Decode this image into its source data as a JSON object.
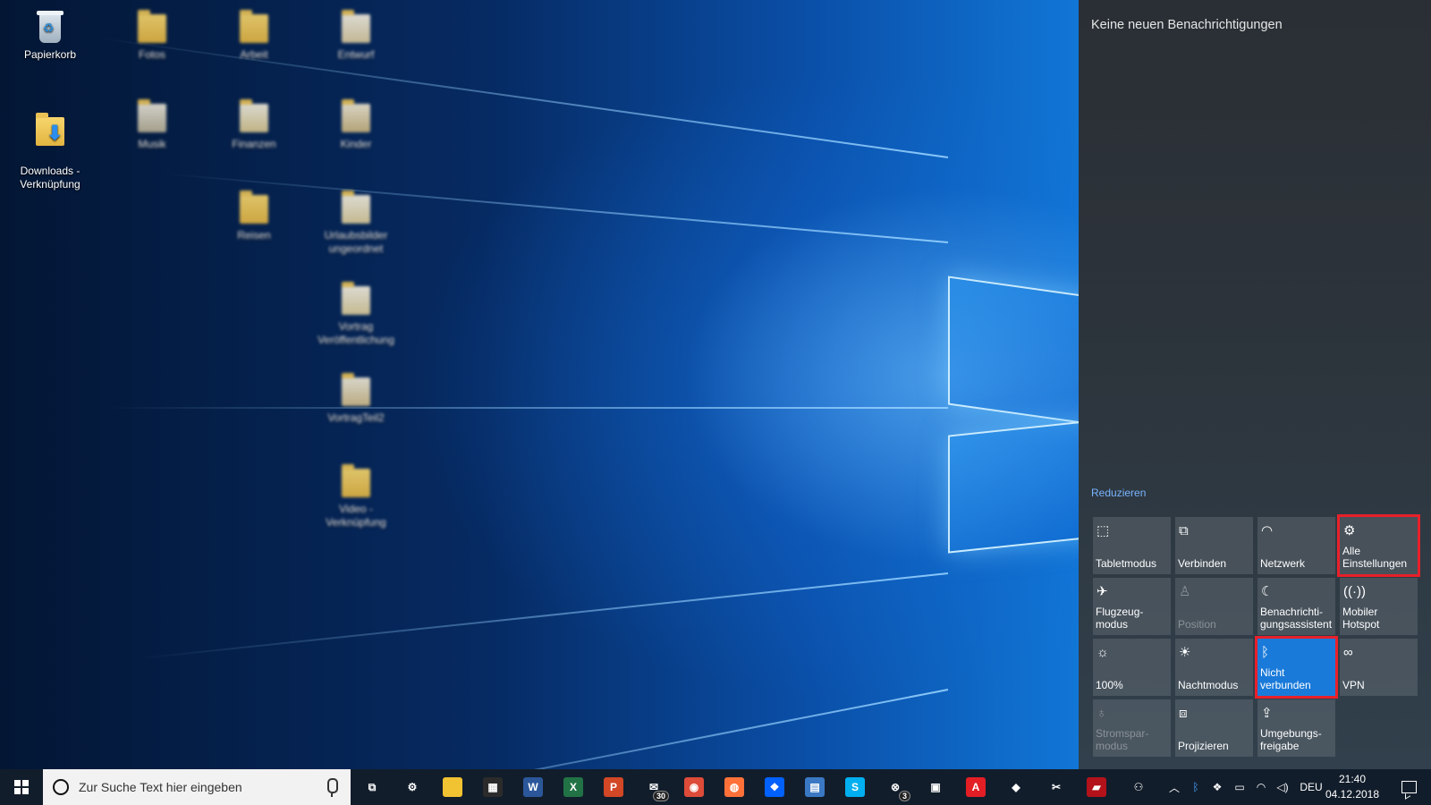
{
  "desktop": {
    "icons": [
      {
        "label": "Papierkorb",
        "type": "recycle-bin",
        "blurred": false
      },
      {
        "label": "Downloads -\nVerknüpfung",
        "type": "shortcut-folder",
        "blurred": false
      },
      {
        "label": "Fotos",
        "type": "folder",
        "blurred": true
      },
      {
        "label": "Musik",
        "type": "folder",
        "blurred": true
      },
      {
        "label": "Arbeit",
        "type": "folder",
        "blurred": true
      },
      {
        "label": "Finanzen",
        "type": "folder",
        "blurred": true
      },
      {
        "label": "Reisen",
        "type": "folder",
        "blurred": true
      },
      {
        "label": "Entwurf",
        "type": "folder",
        "blurred": true
      },
      {
        "label": "Kinder",
        "type": "folder",
        "blurred": true
      },
      {
        "label": "Urlaubsbilder ungeordnet",
        "type": "folder",
        "blurred": true
      },
      {
        "label": "Vortrag Veröffentlichung",
        "type": "folder",
        "blurred": true
      },
      {
        "label": "VortragTeil2",
        "type": "folder",
        "blurred": true
      },
      {
        "label": "Video - Verknüpfung",
        "type": "shortcut-folder",
        "blurred": true
      }
    ]
  },
  "action_center": {
    "title": "Keine neuen Benachrichtigungen",
    "reduce_label": "Reduzieren",
    "tiles": [
      {
        "label": "Tabletmodus",
        "icon": "tablet-mode-icon",
        "glyph": "⬚",
        "state": "normal",
        "highlighted": false
      },
      {
        "label": "Verbinden",
        "icon": "connect-icon",
        "glyph": "⧉",
        "state": "normal",
        "highlighted": false
      },
      {
        "label": "Netzwerk",
        "icon": "network-icon",
        "glyph": "◠",
        "state": "normal",
        "highlighted": false
      },
      {
        "label": "Alle\nEinstellungen",
        "icon": "gear-icon",
        "glyph": "⚙",
        "state": "normal",
        "highlighted": true
      },
      {
        "label": "Flugzeug-\nmodus",
        "icon": "airplane-icon",
        "glyph": "✈",
        "state": "normal",
        "highlighted": false
      },
      {
        "label": "Position",
        "icon": "location-icon",
        "glyph": "♙",
        "state": "disabled",
        "highlighted": false
      },
      {
        "label": "Benachrichti-\ngungsassistent",
        "icon": "moon-icon",
        "glyph": "☾",
        "state": "normal",
        "highlighted": false
      },
      {
        "label": "Mobiler\nHotspot",
        "icon": "hotspot-icon",
        "glyph": "((·))",
        "state": "normal",
        "highlighted": false
      },
      {
        "label": "100%",
        "icon": "brightness-icon",
        "glyph": "☼",
        "state": "normal",
        "highlighted": false
      },
      {
        "label": "Nachtmodus",
        "icon": "night-light-icon",
        "glyph": "☀",
        "state": "normal",
        "highlighted": false
      },
      {
        "label": "Nicht\nverbunden",
        "icon": "bluetooth-icon",
        "glyph": "ᛒ",
        "state": "active",
        "highlighted": true
      },
      {
        "label": "VPN",
        "icon": "vpn-icon",
        "glyph": "∞",
        "state": "normal",
        "highlighted": false
      },
      {
        "label": "Stromspar-\nmodus",
        "icon": "battery-saver-icon",
        "glyph": "♁",
        "state": "disabled",
        "highlighted": false
      },
      {
        "label": "Projizieren",
        "icon": "project-icon",
        "glyph": "⧈",
        "state": "normal",
        "highlighted": false
      },
      {
        "label": "Umgebungs-\nfreigabe",
        "icon": "nearby-sharing-icon",
        "glyph": "⇪",
        "state": "normal",
        "highlighted": false
      }
    ]
  },
  "taskbar": {
    "search_placeholder": "Zur Suche Text hier eingeben",
    "pinned_apps": [
      {
        "name": "task-view-icon",
        "glyph": "⧉",
        "color": "#121d2b",
        "badge": ""
      },
      {
        "name": "settings-icon",
        "glyph": "⚙",
        "color": "#121d2b",
        "badge": ""
      },
      {
        "name": "file-explorer-icon",
        "glyph": "",
        "color": "#f1c232",
        "badge": ""
      },
      {
        "name": "calculator-icon",
        "glyph": "▦",
        "color": "#2b2b2b",
        "badge": ""
      },
      {
        "name": "word-icon",
        "glyph": "W",
        "color": "#2b579a",
        "badge": ""
      },
      {
        "name": "excel-icon",
        "glyph": "X",
        "color": "#217346",
        "badge": ""
      },
      {
        "name": "powerpoint-icon",
        "glyph": "P",
        "color": "#d24726",
        "badge": ""
      },
      {
        "name": "mail-icon",
        "glyph": "✉",
        "color": "#121d2b",
        "badge": "30"
      },
      {
        "name": "chrome-icon",
        "glyph": "◉",
        "color": "#dd4b39",
        "badge": ""
      },
      {
        "name": "firefox-icon",
        "glyph": "◍",
        "color": "#ff7139",
        "badge": ""
      },
      {
        "name": "dropbox-icon",
        "glyph": "❖",
        "color": "#0061fe",
        "badge": ""
      },
      {
        "name": "file-share-icon",
        "glyph": "▤",
        "color": "#3a78c3",
        "badge": ""
      },
      {
        "name": "skype-icon",
        "glyph": "S",
        "color": "#00aff0",
        "badge": ""
      },
      {
        "name": "xbox-icon",
        "glyph": "⊗",
        "color": "#121d2b",
        "badge": "3"
      },
      {
        "name": "store-icon",
        "glyph": "▣",
        "color": "#121d2b",
        "badge": ""
      },
      {
        "name": "acrobat-icon",
        "glyph": "A",
        "color": "#e31e24",
        "badge": ""
      },
      {
        "name": "paint3d-icon",
        "glyph": "◆",
        "color": "#121d2b",
        "badge": ""
      },
      {
        "name": "snipping-tool-icon",
        "glyph": "✂",
        "color": "#121d2b",
        "badge": ""
      },
      {
        "name": "gaming-app-icon",
        "glyph": "▰",
        "color": "#b3121b",
        "badge": ""
      }
    ],
    "tray": {
      "people_icon": "people-icon",
      "chevron_icon": "chevron-up-icon",
      "bluetooth_icon": "bluetooth-tray-icon",
      "dropbox_icon": "dropbox-tray-icon",
      "battery_icon": "battery-icon",
      "wifi_icon": "wifi-icon",
      "volume_icon": "volume-icon",
      "language": "DEU",
      "time": "21:40",
      "date": "04.12.2018"
    }
  },
  "colors": {
    "accent": "#1a7ad9",
    "highlight_box": "#e8202a",
    "link": "#78b4ff"
  }
}
